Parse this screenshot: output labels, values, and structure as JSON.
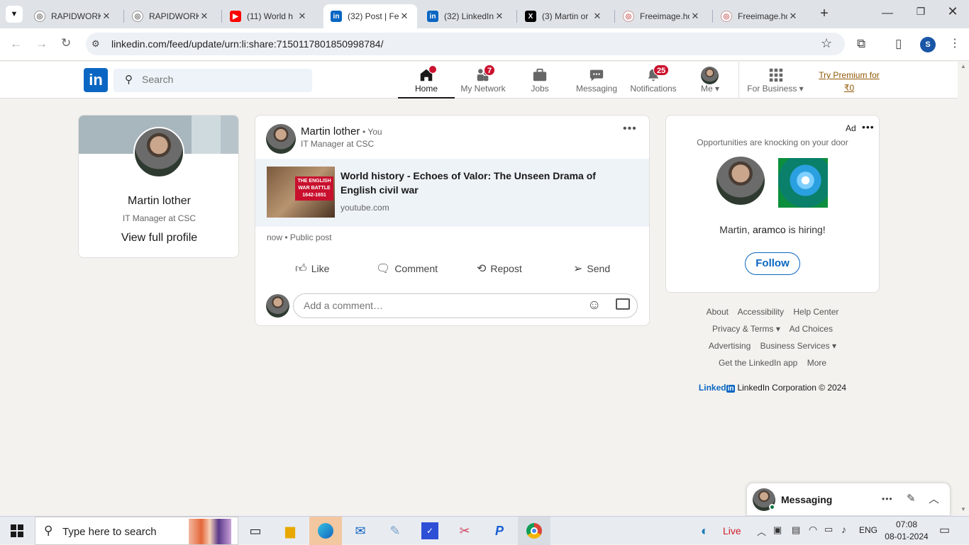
{
  "tabs": [
    {
      "title": "RAPIDWORK",
      "favicon": "rapidworks-icon",
      "active": false
    },
    {
      "title": "RAPIDWORK",
      "favicon": "rapidworks-icon",
      "active": false
    },
    {
      "title": "(11) World h",
      "favicon": "youtube-icon",
      "active": false
    },
    {
      "title": "(32) Post | Fe",
      "favicon": "linkedin-icon",
      "active": true
    },
    {
      "title": "(32) LinkedIn",
      "favicon": "linkedin-icon",
      "active": false
    },
    {
      "title": "(3) Martin or",
      "favicon": "x-icon",
      "active": false
    },
    {
      "title": "Freeimage.ho",
      "favicon": "freeimage-icon",
      "active": false
    },
    {
      "title": "Freeimage.ho",
      "favicon": "freeimage-icon",
      "active": false
    }
  ],
  "url": "linkedin.com/feed/update/urn:li:share:7150117801850998784/",
  "profile_initial": "S",
  "search": {
    "placeholder": "Search"
  },
  "nav": {
    "home": "Home",
    "network": "My Network",
    "network_badge": "7",
    "jobs": "Jobs",
    "messaging": "Messaging",
    "notifications": "Notifications",
    "notifications_badge": "25",
    "me": "Me",
    "business": "For Business",
    "premium": "Try Premium for ₹0"
  },
  "profile_card": {
    "name": "Martin lother",
    "headline": "IT Manager at CSC",
    "view_link": "View full profile"
  },
  "post": {
    "author": "Martin lother",
    "you": "• You",
    "headline": "IT Manager at CSC",
    "link_title": "World history - Echoes of Valor: The Unseen Drama of English civil war",
    "link_domain": "youtube.com",
    "thumb_text": "THE ENGLISH WAR BATTLE 1642-1651",
    "meta": "now • Public post",
    "actions": {
      "like": "Like",
      "comment": "Comment",
      "repost": "Repost",
      "send": "Send"
    },
    "comment_placeholder": "Add a comment…"
  },
  "ad": {
    "label": "Ad",
    "tagline": "Opportunities are knocking on your door",
    "message_prefix": "Martin,",
    "company": "aramco",
    "message_suffix": "is hiring!",
    "follow": "Follow"
  },
  "footer": {
    "about": "About",
    "accessibility": "Accessibility",
    "help": "Help Center",
    "privacy": "Privacy & Terms",
    "adchoices": "Ad Choices",
    "advertising": "Advertising",
    "business_services": "Business Services",
    "app": "Get the LinkedIn app",
    "more": "More",
    "brand": "Linked",
    "copyright": "LinkedIn Corporation © 2024"
  },
  "messaging_bar": {
    "label": "Messaging"
  },
  "taskbar": {
    "search_placeholder": "Type here to search",
    "weather": "Live",
    "lang": "ENG",
    "time": "07:08",
    "date": "08-01-2024"
  },
  "colors": {
    "linkedin_blue": "#0a66c2",
    "badge_red": "#cb112d",
    "bg": "#f4f2ee"
  }
}
